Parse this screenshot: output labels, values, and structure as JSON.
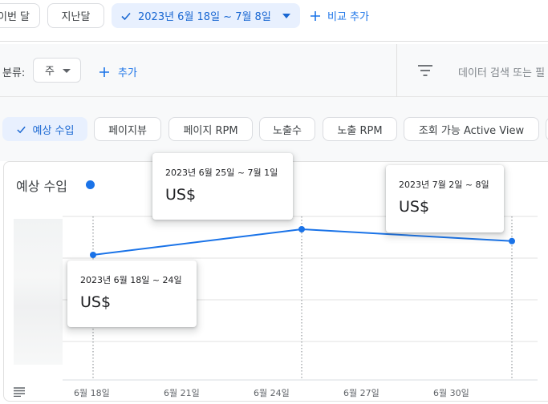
{
  "date_bar": {
    "this_month": "이번 달",
    "last_month": "지난달",
    "range": "2023년 6월 18일 ~ 7월 8일",
    "compare": "비교 추가"
  },
  "filter_bar": {
    "group_label": "분류:",
    "group_value": "주",
    "add": "추가",
    "search_placeholder": "데이터 검색 또는 필"
  },
  "metrics": [
    {
      "label": "예상 수입",
      "selected": true
    },
    {
      "label": "페이지뷰",
      "selected": false
    },
    {
      "label": "페이지 RPM",
      "selected": false
    },
    {
      "label": "노출수",
      "selected": false
    },
    {
      "label": "노출 RPM",
      "selected": false
    },
    {
      "label": "조회 가능 Active View",
      "selected": false
    }
  ],
  "chart": {
    "title": "예상 수입",
    "series_color": "#1a73e8",
    "tooltips": [
      {
        "date": "2023년 6월 18일 ~ 24일",
        "value": "US$"
      },
      {
        "date": "2023년 6월 25일 ~ 7월 1일",
        "value": "US$"
      },
      {
        "date": "2023년 7월 2일 ~ 8일",
        "value": "US$"
      }
    ],
    "x_ticks": [
      "6월 18일",
      "6월 21일",
      "6월 24일",
      "6월 27일",
      "6월 30일"
    ]
  },
  "chart_data": {
    "type": "line",
    "x": [
      "2023년 6월 18일 ~ 24일",
      "2023년 6월 25일 ~ 7월 1일",
      "2023년 7월 2일 ~ 8일"
    ],
    "series": [
      {
        "values": [
          0.74,
          1.0,
          0.88
        ]
      }
    ],
    "title": "예상 수입",
    "y_tick_labels_hidden": true,
    "grid": true
  }
}
